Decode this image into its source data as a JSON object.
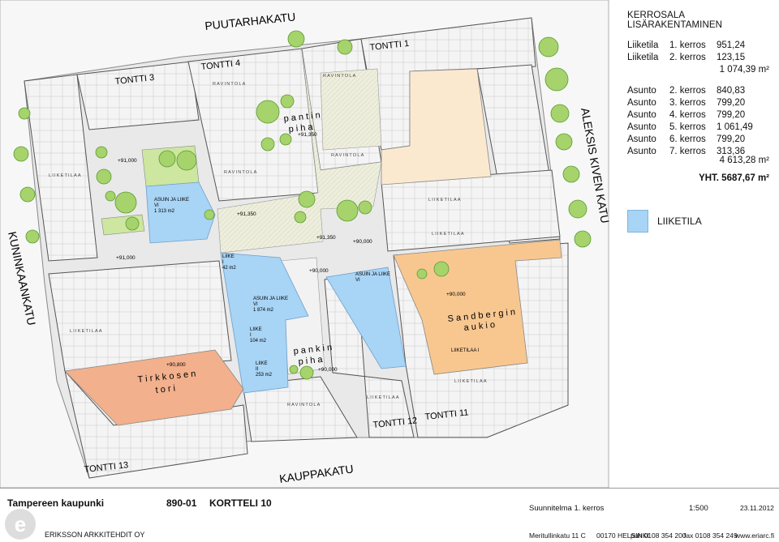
{
  "plan": {
    "streets": {
      "north": "PUUTARHAKATU",
      "east": "ALEKSIS KIVEN KATU",
      "south": "KAUPPAKATU",
      "west": "KUNINKAANKATU"
    },
    "plots": {
      "t1": "TONTTI 1",
      "t3": "TONTTI 3",
      "t4": "TONTTI 4",
      "t11": "TONTTI 11",
      "t12": "TONTTI 12",
      "t13": "TONTTI 13"
    },
    "squares": {
      "pantin_1": "p a n t i n",
      "pantin_2": "p i h a",
      "pankin_1": "p a n k i n",
      "pankin_2": "p i h a",
      "tirkkosen_1": "T i r k k o s e n",
      "tirkkosen_2": "t o r i",
      "sandbergin_1": "S a n d b e r g i n",
      "sandbergin_2": "a u k i o"
    },
    "levels": {
      "l1": "+91,000",
      "l2": "+91,000",
      "l3": "+91,350",
      "l4": "+91,350",
      "l5": "+91,350",
      "l6": "+90,000",
      "l7": "+90,000",
      "l8": "+90,000",
      "l9": "+90,000",
      "l10": "+90,800"
    },
    "units": {
      "u1a": "ASUIN JA LIIKE",
      "u1b": "VI",
      "u1c": "1 313 m2",
      "u2a": "LIIKE",
      "u2b": "I",
      "u2c": "42 m2",
      "u3a": "ASUIN JA LIIKE",
      "u3b": "VI",
      "u3c": "1 874 m2",
      "u4a": "LIIKE",
      "u4b": "I",
      "u4c": "104 m2",
      "u5a": "LIIKE",
      "u5b": "II",
      "u5c": "253 m2",
      "u6a": "ASUIN JA LIIKE",
      "u6b": "VI",
      "u7": "LIIKETILAA I"
    },
    "small": {
      "liike1": "LIIKETILAA",
      "liike2": "LIIKETILAA",
      "liike3": "LIIKETILAA",
      "liike4": "LIIKETILAA",
      "liike5": "LIIKETILAA",
      "liike6": "LIIKETILAA",
      "ravin1": "RAVINTOLA",
      "ravin2": "RAVINTOLA",
      "ravin3": "RAVINTOLA",
      "ravin4": "RAVINTOLA",
      "ravin5": "RAVINTOLA"
    }
  },
  "legend": {
    "title": "KERROSALA LISÄRAKENTAMINEN",
    "commercial": [
      {
        "use": "Liiketila",
        "floor": "1. kerros",
        "area": "951,24"
      },
      {
        "use": "Liiketila",
        "floor": "2. kerros",
        "area": "123,15"
      }
    ],
    "commercial_total": "1 074,39 m²",
    "residential": [
      {
        "use": "Asunto",
        "floor": "2. kerros",
        "area": "840,83"
      },
      {
        "use": "Asunto",
        "floor": "3. kerros",
        "area": "799,20"
      },
      {
        "use": "Asunto",
        "floor": "4. kerros",
        "area": "799,20"
      },
      {
        "use": "Asunto",
        "floor": "5. kerros",
        "area": "1 061,49"
      },
      {
        "use": "Asunto",
        "floor": "6. kerros",
        "area": "799,20"
      },
      {
        "use": "Asunto",
        "floor": "7. kerros",
        "area": "313,36"
      }
    ],
    "residential_total": "4 613,28 m²",
    "grand_total": "YHT. 5687,67 m²",
    "swatch_label": "LIIKETILA",
    "swatch_color": "#a8d4f5"
  },
  "footer": {
    "city": "Tampereen kaupunki",
    "code": "890-01",
    "block": "KORTTELI 10",
    "plan": "Suunnitelma 1. kerros",
    "scale": "1:500",
    "date": "23.11.2012",
    "office": "ERIKSSON ARKKITEHDIT OY",
    "address": "Meritullinkatu 11 C",
    "postal": "00170 HELSINKI",
    "phone": "puh 0108 354 200",
    "fax": "fax 0108 354 249",
    "web": "www.eriarc.fi",
    "logo_letter": "e"
  }
}
